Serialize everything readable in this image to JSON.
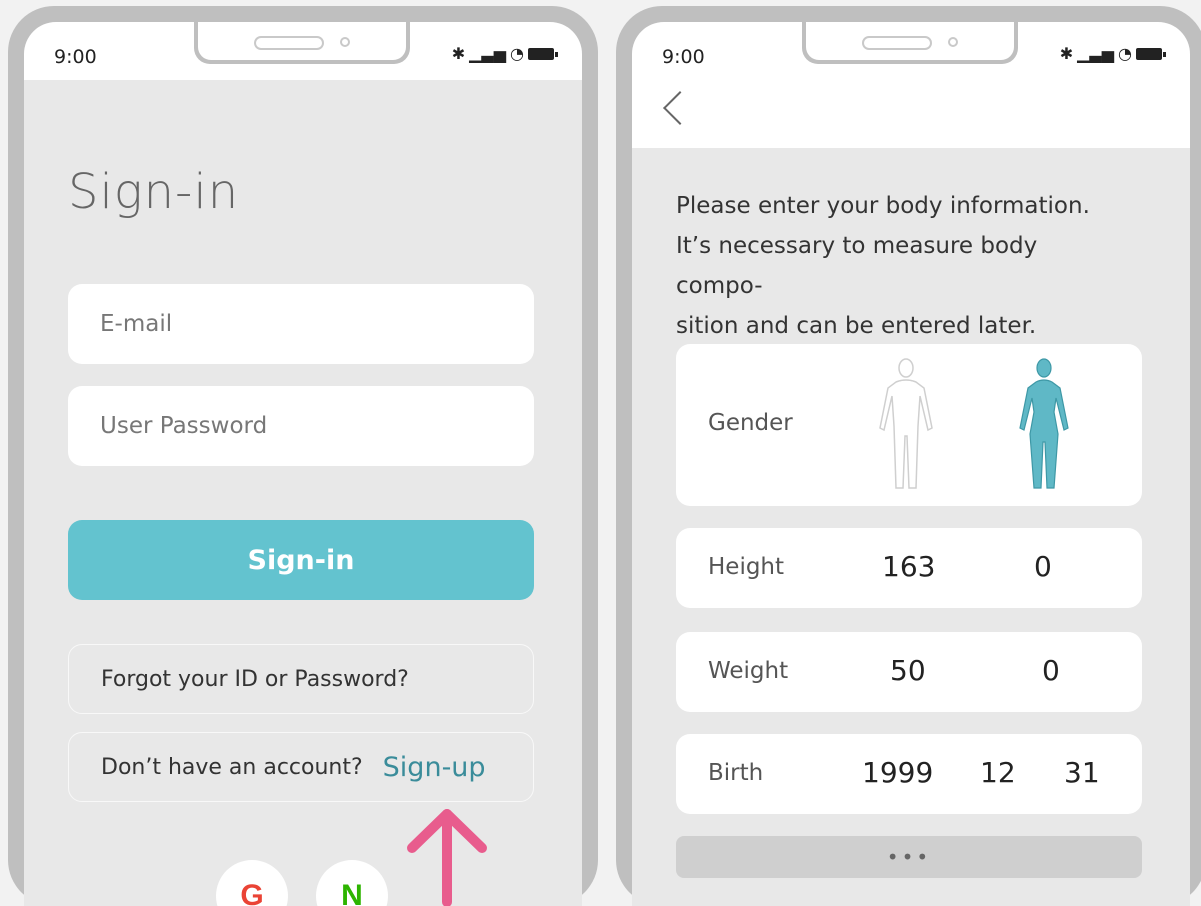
{
  "status": {
    "time": "9:00"
  },
  "signin": {
    "title": "Sign-in",
    "email_placeholder": "E-mail",
    "password_placeholder": "User Password",
    "signin_button": "Sign-in",
    "forgot_text": "Forgot your ID or Password?",
    "no_account_text": "Don’t have an account?",
    "signup_link": "Sign-up",
    "social": [
      {
        "label": "G",
        "icon": "google-icon"
      },
      {
        "label": "N",
        "icon": "naver-icon"
      }
    ],
    "arrow_color": "#e85c8d"
  },
  "body_info": {
    "intro_line1": "Please enter your body information.",
    "intro_line2": "It’s necessary to measure body compo-",
    "intro_line3": "sition and can be entered later.",
    "gender_label": "Gender",
    "height_label": "Height",
    "height_value": "163",
    "height_decimal": "0",
    "weight_label": "Weight",
    "weight_value": "50",
    "weight_decimal": "0",
    "birth_label": "Birth",
    "birth_year": "1999",
    "birth_month": "12",
    "birth_day": "31",
    "more_label": "•••"
  },
  "colors": {
    "accent": "#63c3cf",
    "female_selected": "#5fb8c6"
  }
}
